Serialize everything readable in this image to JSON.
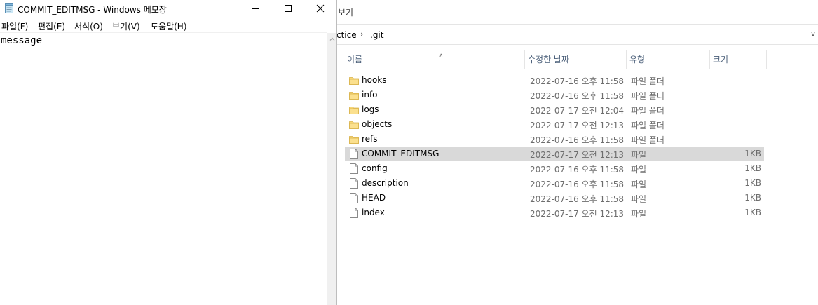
{
  "explorer": {
    "ribbon_tab": "보기",
    "breadcrumb": [
      "ctice",
      ".git"
    ],
    "columns": {
      "name": "이름",
      "date": "수정한 날짜",
      "type": "유형",
      "size": "크기"
    },
    "items": [
      {
        "name": "hooks",
        "date": "2022-07-16 오후 11:58",
        "type": "파일 폴더",
        "size": "",
        "kind": "folder-icon"
      },
      {
        "name": "info",
        "date": "2022-07-16 오후 11:58",
        "type": "파일 폴더",
        "size": "",
        "kind": "folder-icon"
      },
      {
        "name": "logs",
        "date": "2022-07-17 오전 12:04",
        "type": "파일 폴더",
        "size": "",
        "kind": "folder-icon"
      },
      {
        "name": "objects",
        "date": "2022-07-17 오전 12:13",
        "type": "파일 폴더",
        "size": "",
        "kind": "folder-icon"
      },
      {
        "name": "refs",
        "date": "2022-07-16 오후 11:58",
        "type": "파일 폴더",
        "size": "",
        "kind": "folder-icon"
      },
      {
        "name": "COMMIT_EDITMSG",
        "date": "2022-07-17 오전 12:13",
        "type": "파일",
        "size": "1KB",
        "kind": "file-icon",
        "selected": true
      },
      {
        "name": "config",
        "date": "2022-07-16 오후 11:58",
        "type": "파일",
        "size": "1KB",
        "kind": "file-icon"
      },
      {
        "name": "description",
        "date": "2022-07-16 오후 11:58",
        "type": "파일",
        "size": "1KB",
        "kind": "file-icon"
      },
      {
        "name": "HEAD",
        "date": "2022-07-16 오후 11:58",
        "type": "파일",
        "size": "1KB",
        "kind": "file-icon"
      },
      {
        "name": "index",
        "date": "2022-07-17 오전 12:13",
        "type": "파일",
        "size": "1KB",
        "kind": "file-icon"
      }
    ]
  },
  "notepad": {
    "title": "COMMIT_EDITMSG - Windows 메모장",
    "menu": [
      "파일(F)",
      "편집(E)",
      "서식(O)",
      "보기(V)",
      "도움말(H)"
    ],
    "content": "message"
  },
  "colors": {
    "selection": "#d9d9d9",
    "folder": "#f8d775",
    "header_text": "#4c607a"
  }
}
